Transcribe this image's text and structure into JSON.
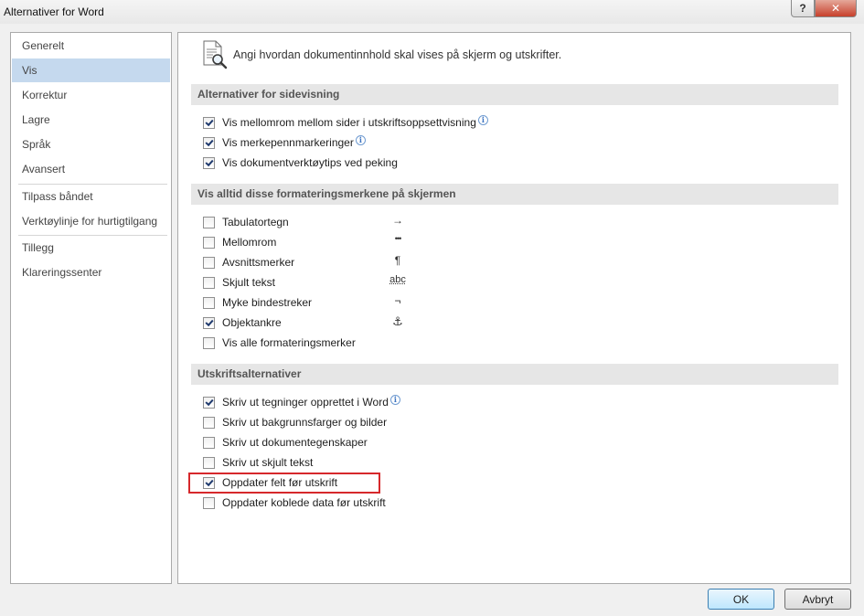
{
  "window": {
    "title": "Alternativer for Word",
    "help_label": "?",
    "close_label": "✕"
  },
  "nav": {
    "items": [
      {
        "label": "Generelt",
        "selected": false
      },
      {
        "label": "Vis",
        "selected": true
      },
      {
        "label": "Korrektur",
        "selected": false
      },
      {
        "label": "Lagre",
        "selected": false
      },
      {
        "label": "Språk",
        "selected": false
      },
      {
        "label": "Avansert",
        "selected": false
      },
      {
        "label": "Tilpass båndet",
        "selected": false
      },
      {
        "label": "Verktøylinje for hurtigtilgang",
        "selected": false
      },
      {
        "label": "Tillegg",
        "selected": false
      },
      {
        "label": "Klareringssenter",
        "selected": false
      }
    ]
  },
  "intro": {
    "text": "Angi hvordan dokumentinnhold skal vises på skjerm og utskrifter."
  },
  "sections": {
    "page_display": {
      "title": "Alternativer for sidevisning",
      "options": [
        {
          "label": "Vis mellomrom mellom sider i utskriftsoppsettvisning",
          "checked": true,
          "info": true
        },
        {
          "label": "Vis merkepennmarkeringer",
          "checked": true,
          "info": true
        },
        {
          "label": "Vis dokumentverktøytips ved peking",
          "checked": true,
          "info": false
        }
      ]
    },
    "formatting_marks": {
      "title": "Vis alltid disse formateringsmerkene på skjermen",
      "options": [
        {
          "label": "Tabulatortegn",
          "checked": false,
          "symbol": "→"
        },
        {
          "label": "Mellomrom",
          "checked": false,
          "symbol": "•••"
        },
        {
          "label": "Avsnittsmerker",
          "checked": false,
          "symbol": "¶"
        },
        {
          "label": "Skjult tekst",
          "checked": false,
          "symbol": "abc"
        },
        {
          "label": "Myke bindestreker",
          "checked": false,
          "symbol": "¬"
        },
        {
          "label": "Objektankre",
          "checked": true,
          "symbol": "⚓"
        },
        {
          "label": "Vis alle formateringsmerker",
          "checked": false,
          "symbol": ""
        }
      ]
    },
    "print": {
      "title": "Utskriftsalternativer",
      "options": [
        {
          "label": "Skriv ut tegninger opprettet i Word",
          "checked": true,
          "info": true
        },
        {
          "label": "Skriv ut bakgrunnsfarger og bilder",
          "checked": false,
          "info": false
        },
        {
          "label": "Skriv ut dokumentegenskaper",
          "checked": false,
          "info": false
        },
        {
          "label": "Skriv ut skjult tekst",
          "checked": false,
          "info": false
        },
        {
          "label": "Oppdater felt før utskrift",
          "checked": true,
          "info": false,
          "highlighted": true
        },
        {
          "label": "Oppdater koblede data før utskrift",
          "checked": false,
          "info": false
        }
      ]
    }
  },
  "buttons": {
    "ok_label": "OK",
    "cancel_label": "Avbryt"
  },
  "colors": {
    "selected_nav": "#c5d9ee",
    "highlight_border": "#d6282b",
    "section_bg": "#e6e6e6"
  }
}
